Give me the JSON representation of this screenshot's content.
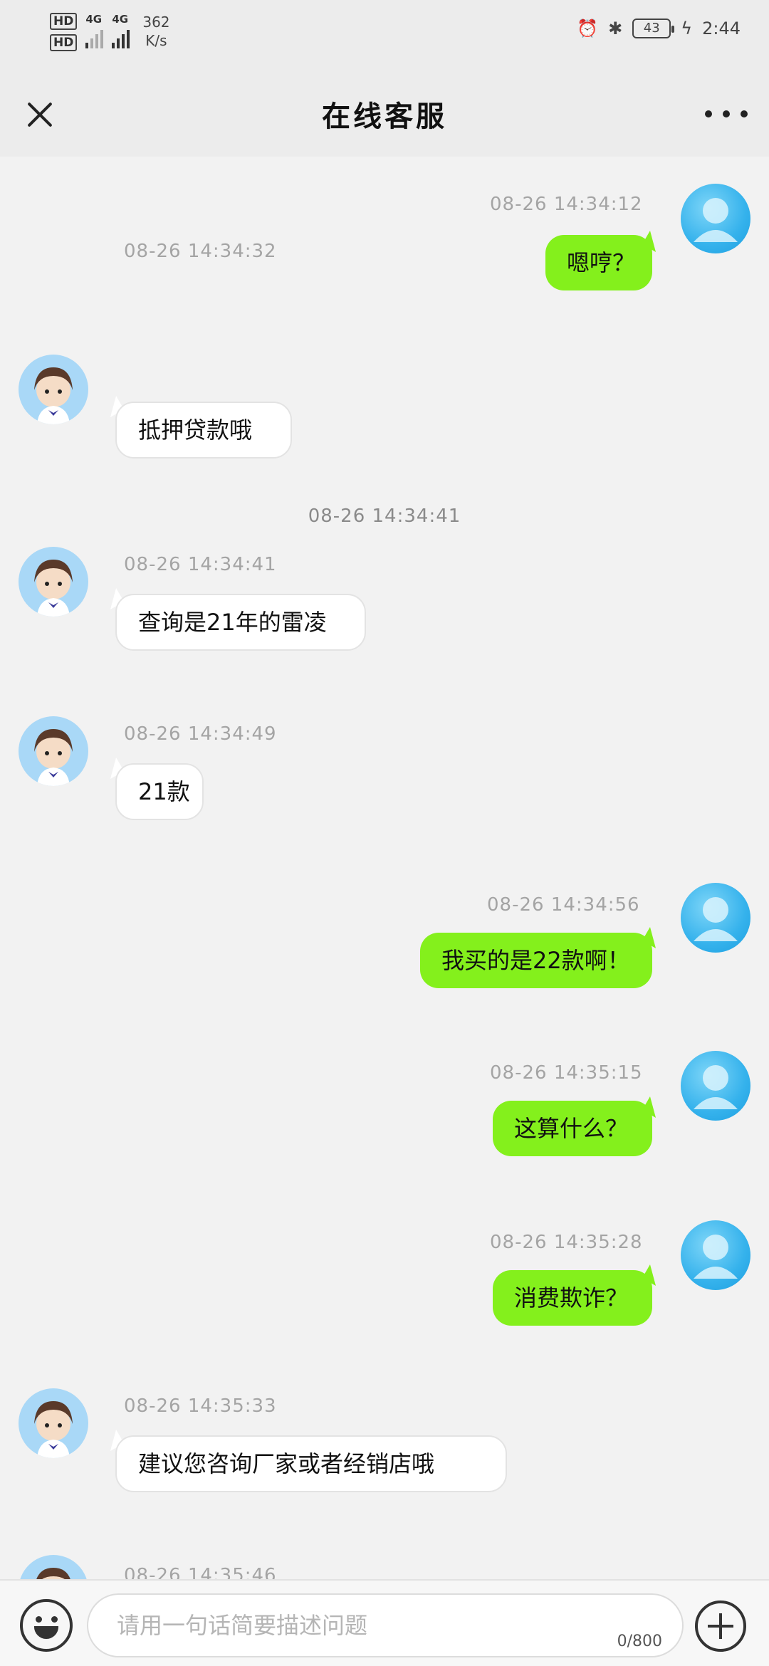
{
  "status_bar": {
    "hd1": "HD",
    "hd2": "HD",
    "sim1_net": "4G",
    "sim2_net": "4G",
    "speed_value": "362",
    "speed_unit": "K/s",
    "battery": "43",
    "time": "2:44"
  },
  "header": {
    "title": "在线客服",
    "close_icon": "close-icon",
    "more_icon": "more-icon"
  },
  "messages": [
    {
      "sender": "user",
      "time": "08-26 14:34:12",
      "text": "嗯哼？"
    },
    {
      "sender": "agent",
      "time": "08-26 14:34:32",
      "text": "抵押贷款哦"
    },
    {
      "sender": "system",
      "time": "08-26 14:34:41"
    },
    {
      "sender": "agent",
      "time": "08-26 14:34:41",
      "text": "查询是21年的雷凌"
    },
    {
      "sender": "agent",
      "time": "08-26 14:34:49",
      "text": "21款"
    },
    {
      "sender": "user",
      "time": "08-26 14:34:56",
      "text": "我买的是22款啊！"
    },
    {
      "sender": "user",
      "time": "08-26 14:35:15",
      "text": "这算什么？"
    },
    {
      "sender": "user",
      "time": "08-26 14:35:28",
      "text": "消费欺诈？"
    },
    {
      "sender": "agent",
      "time": "08-26 14:35:33",
      "text": "建议您咨询厂家或者经销店哦"
    },
    {
      "sender": "agent",
      "time": "08-26 14:35:46",
      "text": ""
    }
  ],
  "input": {
    "placeholder": "请用一句话简要描述问题",
    "value": "",
    "counter": "0/800"
  },
  "icons": {
    "emoji": "emoji-icon",
    "plus": "plus-icon"
  }
}
